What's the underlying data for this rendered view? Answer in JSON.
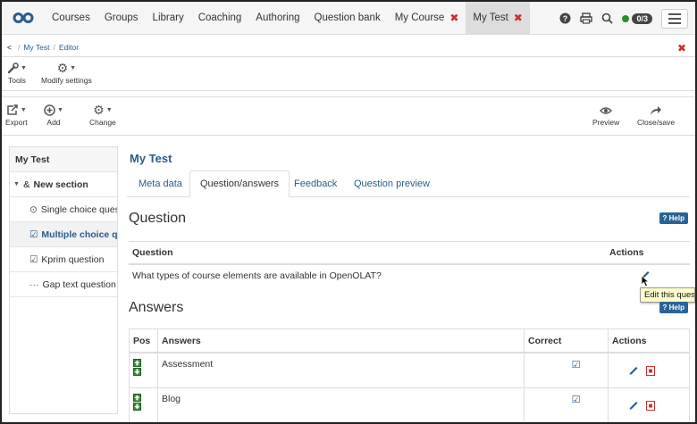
{
  "nav": {
    "items": [
      {
        "label": "Courses"
      },
      {
        "label": "Groups"
      },
      {
        "label": "Library"
      },
      {
        "label": "Coaching"
      },
      {
        "label": "Authoring"
      },
      {
        "label": "Question bank"
      },
      {
        "label": "My Course"
      },
      {
        "label": "My Test"
      }
    ],
    "badge": "0/3"
  },
  "breadcrumb": {
    "items": [
      "My Test",
      "Editor"
    ]
  },
  "toolbar1": {
    "tools": "Tools",
    "modify": "Modify settings"
  },
  "toolbar2": {
    "export": "Export",
    "add": "Add",
    "change": "Change",
    "preview": "Preview",
    "closesave": "Close/save"
  },
  "tree": {
    "root": "My Test",
    "section": "New section",
    "items": [
      {
        "label": "Single choice question"
      },
      {
        "label": "Multiple choice question"
      },
      {
        "label": "Kprim question"
      },
      {
        "label": "Gap text question"
      }
    ]
  },
  "main": {
    "title": "My Test",
    "tabs": [
      {
        "label": "Meta data"
      },
      {
        "label": "Question/answers"
      },
      {
        "label": "Feedback"
      },
      {
        "label": "Question preview"
      }
    ],
    "question_heading": "Question",
    "help": "Help",
    "qtable": {
      "col_question": "Question",
      "col_actions": "Actions",
      "text": "What types of course elements are available in OpenOLAT?"
    },
    "tooltip": "Edit this question",
    "answers_heading": "Answers",
    "atable": {
      "cols": [
        "Pos",
        "Answers",
        "Correct",
        "Actions"
      ],
      "rows": [
        {
          "answer": "Assessment"
        },
        {
          "answer": "Blog"
        }
      ]
    }
  },
  "colors": {
    "accent": "#2a5d8c",
    "danger": "#c9302c",
    "move": "#3d8b3d"
  }
}
